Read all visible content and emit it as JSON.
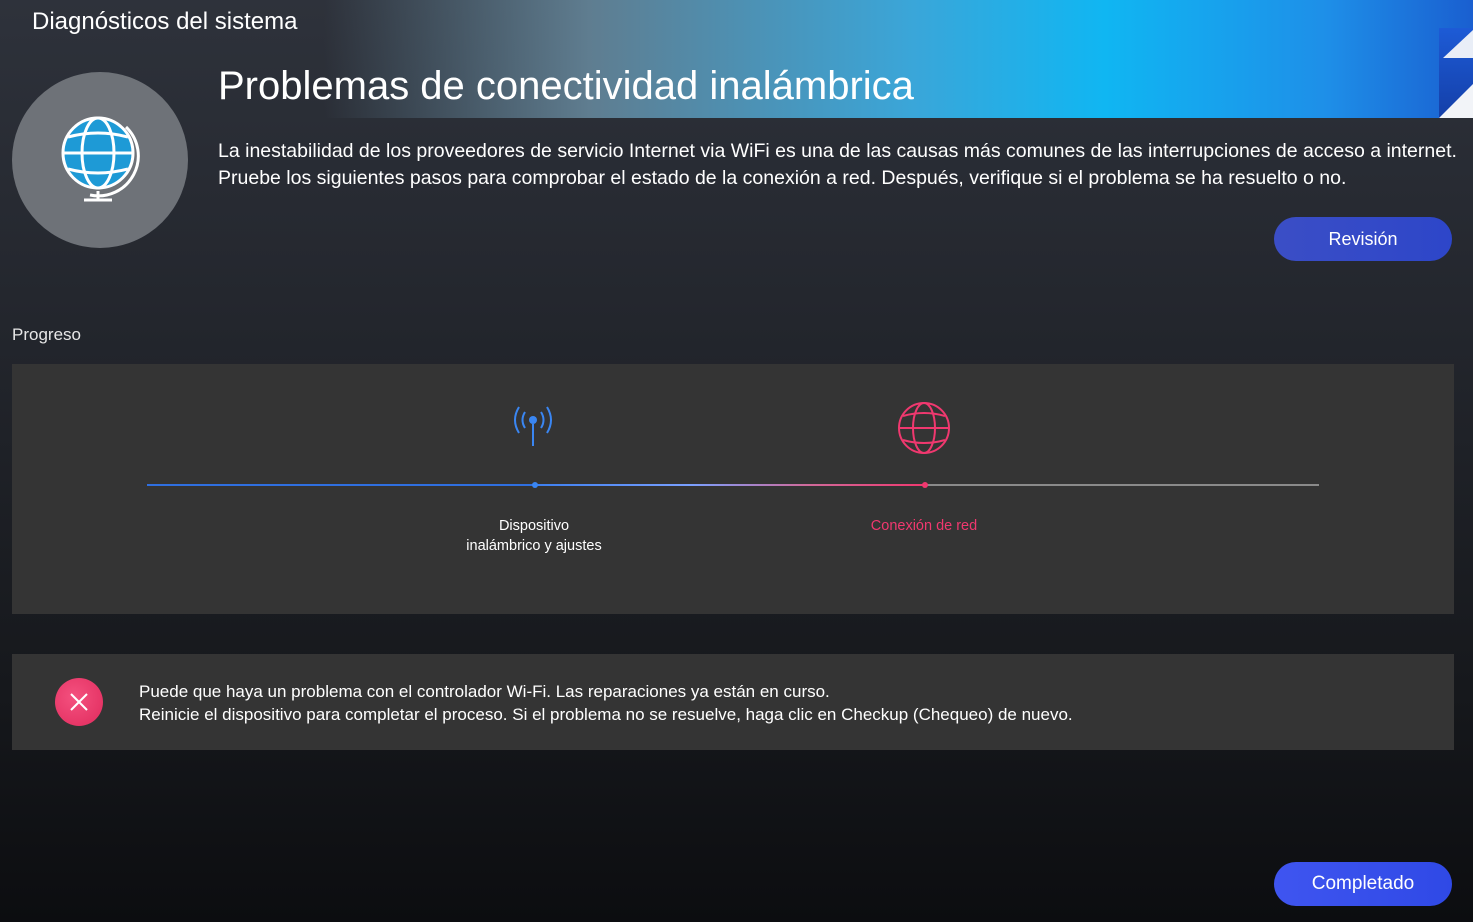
{
  "app": {
    "title": "Diagnósticos del sistema"
  },
  "header": {
    "title": "Problemas de conectividad inalámbrica",
    "description": "La inestabilidad de los proveedores de servicio Internet via WiFi es una de las causas más comunes de las interrupciones de acceso a internet. Pruebe los siguientes pasos para comprobar el estado de la conexión a red. Después, verifique si el problema se ha resuelto o no.",
    "hero_icon": "globe-icon",
    "review_button": "Revisión"
  },
  "progress": {
    "label": "Progreso",
    "steps": [
      {
        "icon": "wifi-antenna-icon",
        "line1": "Dispositivo",
        "line2": "inalámbrico y ajustes",
        "status": "completed",
        "color": "#3a86f2"
      },
      {
        "icon": "globe-icon",
        "line1": "Conexión de red",
        "line2": "",
        "status": "error",
        "color": "#f0386f"
      }
    ]
  },
  "result": {
    "icon": "close-icon",
    "status_color": "#e8336a",
    "line1": "Puede que haya un problema con el controlador Wi-Fi. Las reparaciones ya están en curso.",
    "line2": "Reinicie el dispositivo para completar el proceso. Si el problema no se resuelve, haga clic en Checkup (Chequeo) de nuevo."
  },
  "footer": {
    "done_button": "Completado"
  },
  "colors": {
    "accent": "#2f49e6",
    "error": "#f0386f",
    "panel": "#343434"
  }
}
